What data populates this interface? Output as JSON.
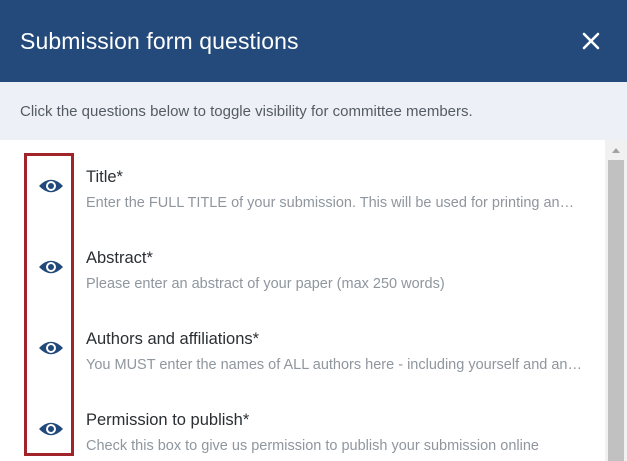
{
  "dialog": {
    "title": "Submission form questions",
    "instructions": "Click the questions below to toggle visibility for committee members."
  },
  "questions": [
    {
      "title": "Title*",
      "description": "Enter the FULL TITLE of your submission. This will be used for printing and publication",
      "visibility_icon": "eye-icon"
    },
    {
      "title": "Abstract*",
      "description": "Please enter an abstract of your paper (max 250 words)",
      "visibility_icon": "eye-icon"
    },
    {
      "title": "Authors and affiliations*",
      "description": "You MUST enter the names of ALL authors here - including yourself and any co-authors",
      "visibility_icon": "eye-icon"
    },
    {
      "title": "Permission to publish*",
      "description": "Check this box to give us permission to publish your submission online",
      "visibility_icon": "eye-icon"
    }
  ],
  "colors": {
    "header_bg": "#244a7c",
    "instructions_bg": "#edf1f7",
    "eye_icon": "#21497c",
    "highlight_border": "#a0242a"
  }
}
